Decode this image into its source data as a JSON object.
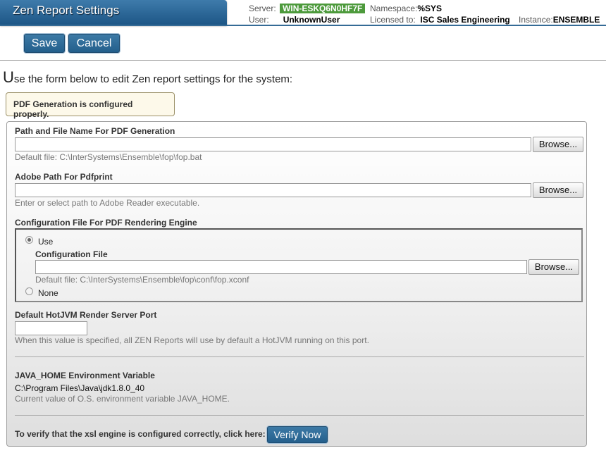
{
  "header": {
    "title": "Zen Report Settings",
    "server_label": "Server:",
    "server_value": "WIN-ESKQ6N0HF7F",
    "namespace_label": "Namespace:",
    "namespace_value": "%SYS",
    "user_label": "User:",
    "user_value": "UnknownUser",
    "licensed_label": "Licensed to:",
    "licensed_value": "ISC Sales Engineering",
    "instance_label": "Instance:",
    "instance_value": "ENSEMBLE"
  },
  "toolbar": {
    "save_label": "Save",
    "cancel_label": "Cancel"
  },
  "intro": {
    "first_letter": "U",
    "rest": "se the form below to edit Zen report settings for the system:"
  },
  "status_message": "PDF Generation is configured properly.",
  "form": {
    "pdf_path": {
      "label": "Path and File Name For PDF Generation",
      "value": "",
      "browse_label": "Browse...",
      "hint": "Default file: C:\\InterSystems\\Ensemble\\fop\\fop.bat"
    },
    "adobe_path": {
      "label": "Adobe Path For Pdfprint",
      "value": "",
      "browse_label": "Browse...",
      "hint": "Enter or select path to Adobe Reader executable."
    },
    "config_file": {
      "label": "Configuration File For PDF Rendering Engine",
      "use_label": "Use",
      "none_label": "None",
      "selected": "Use",
      "file_label": "Configuration File",
      "value": "",
      "browse_label": "Browse...",
      "hint": "Default file: C:\\InterSystems\\Ensemble\\fop\\conf\\fop.xconf"
    },
    "hotjvm_port": {
      "label": "Default HotJVM Render Server Port",
      "value": "",
      "hint": "When this value is specified, all ZEN Reports will use by default a HotJVM running on this port."
    },
    "java_home": {
      "label": "JAVA_HOME Environment Variable",
      "value": "C:\\Program Files\\Java\\jdk1.8.0_40",
      "hint": "Current value of O.S. environment variable JAVA_HOME."
    },
    "verify": {
      "text": "To verify that the xsl engine is configured correctly, click here:",
      "button_label": "Verify Now"
    }
  }
}
